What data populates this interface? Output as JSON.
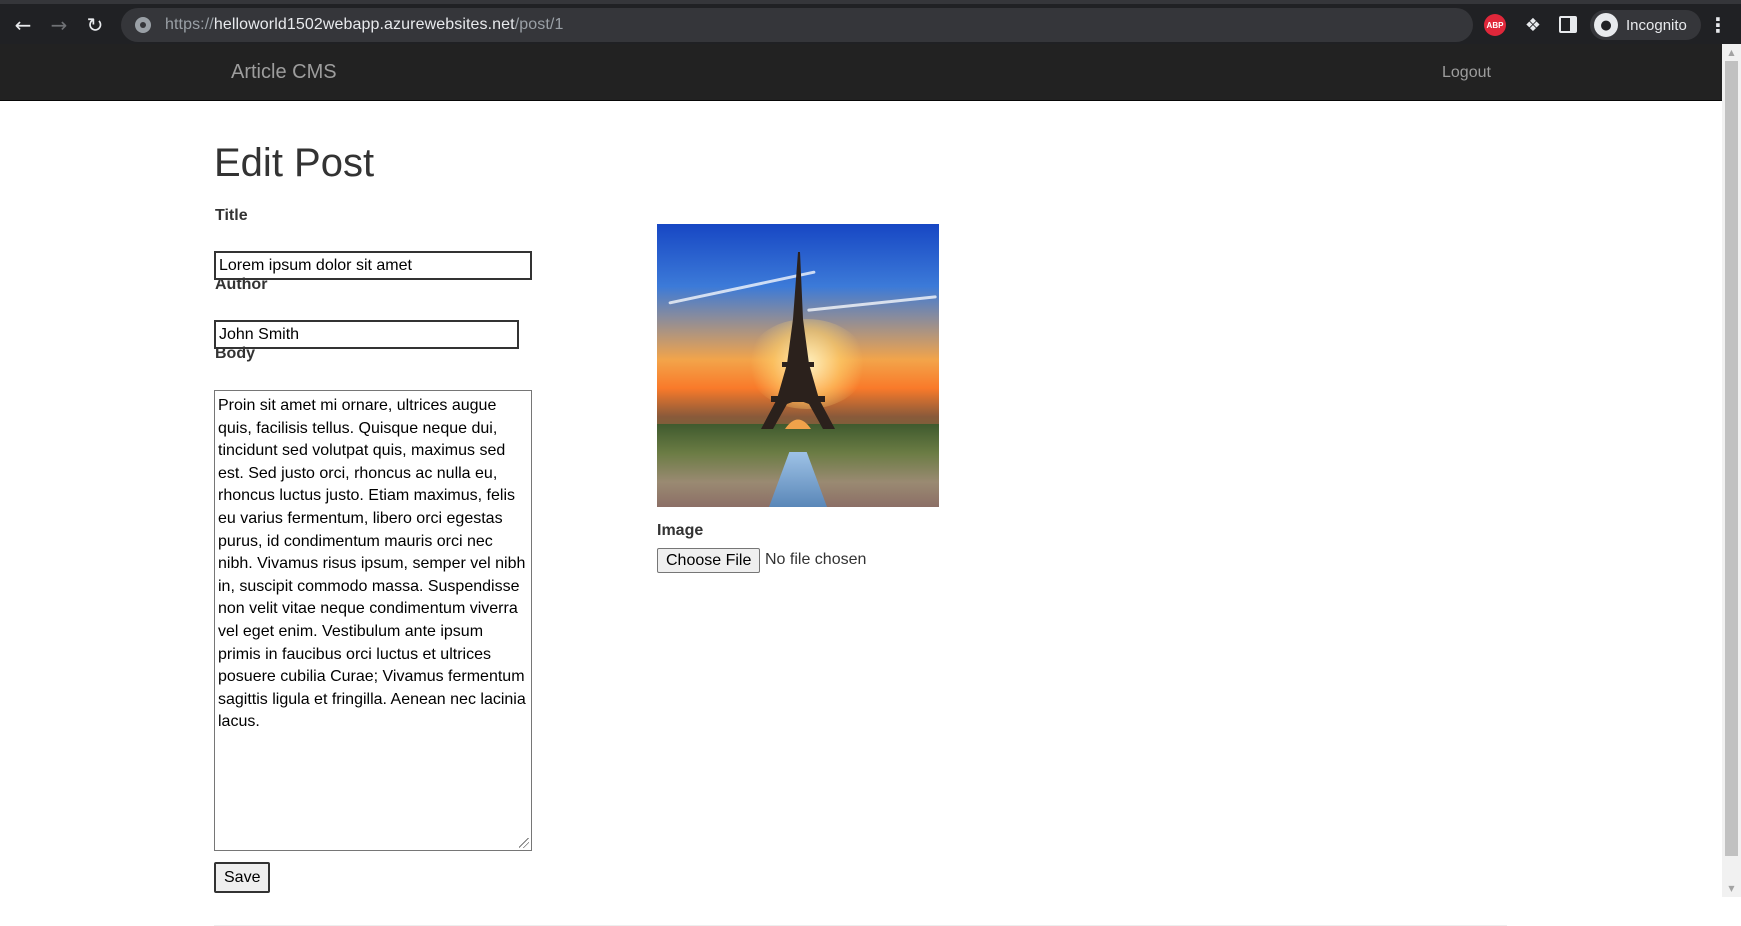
{
  "browser": {
    "url_scheme": "https://",
    "url_host": "helloworld1502webapp.azurewebsites.net",
    "url_path": "/post/1",
    "extension_abp": "ABP",
    "incognito_label": "Incognito",
    "icons": {
      "back": "arrow-left-icon",
      "forward": "arrow-right-icon",
      "reload": "reload-icon",
      "site_info": "site-info-icon",
      "extensions": "puzzle-icon",
      "side_panel": "side-panel-icon",
      "incognito": "incognito-icon",
      "menu": "kebab-menu-icon"
    }
  },
  "navbar": {
    "brand": "Article CMS",
    "logout": "Logout",
    "background": "#222222"
  },
  "page": {
    "title": "Edit Post"
  },
  "form": {
    "title_label": "Title",
    "title_value": "Lorem ipsum dolor sit amet",
    "author_label": "Author",
    "author_value": "John Smith",
    "body_label": "Body",
    "body_value": "Proin sit amet mi ornare, ultrices augue quis, facilisis tellus. Quisque neque dui, tincidunt sed volutpat quis, maximus sed est. Sed justo orci, rhoncus ac nulla eu, rhoncus luctus justo. Etiam maximus, felis eu varius fermentum, libero orci egestas purus, id condimentum mauris orci nec nibh. Vivamus risus ipsum, semper vel nibh in, suscipit commodo massa. Suspendisse non velit vitae neque condimentum viverra vel eget enim. Vestibulum ante ipsum primis in faucibus orci luctus et ultrices posuere cubilia Curae; Vivamus fermentum sagittis ligula et fringilla. Aenean nec lacinia lacus.",
    "save_label": "Save",
    "image_label": "Image",
    "choose_file_label": "Choose File",
    "file_status": "No file chosen"
  }
}
